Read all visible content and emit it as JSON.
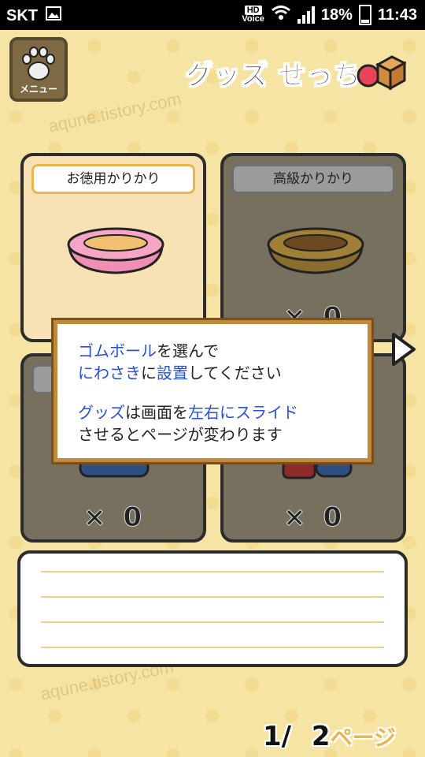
{
  "status_bar": {
    "carrier": "SKT",
    "hd_label": "HD",
    "voice_label": "Voice",
    "battery": "18%",
    "time": "11:43"
  },
  "header": {
    "menu_label": "メニュー",
    "title": "グッズ せっち"
  },
  "cards": [
    {
      "label": "お徳用かりかり",
      "selected": true
    },
    {
      "label": "高級かりかり",
      "count_x": "×",
      "count": "0"
    },
    {
      "count_x": "×",
      "count": "0"
    },
    {
      "count_x": "×",
      "count": "0"
    }
  ],
  "dialog": {
    "line1_a": "ゴムボール",
    "line1_b": "を選んで",
    "line2_a": "にわさき",
    "line2_b": "に",
    "line2_c": "設置",
    "line2_d": "してください",
    "line3_a": "グッズ",
    "line3_b": "は画面を",
    "line3_c": "左右にスライド",
    "line4": "させるとページが変わります"
  },
  "pager": {
    "current": "1/",
    "total": "2",
    "unit": "ページ"
  },
  "watermark": "aqune.tistory.com",
  "colors": {
    "background": "#f6e4a4",
    "highlight": "#2850d8",
    "accent": "#e9b54d"
  }
}
